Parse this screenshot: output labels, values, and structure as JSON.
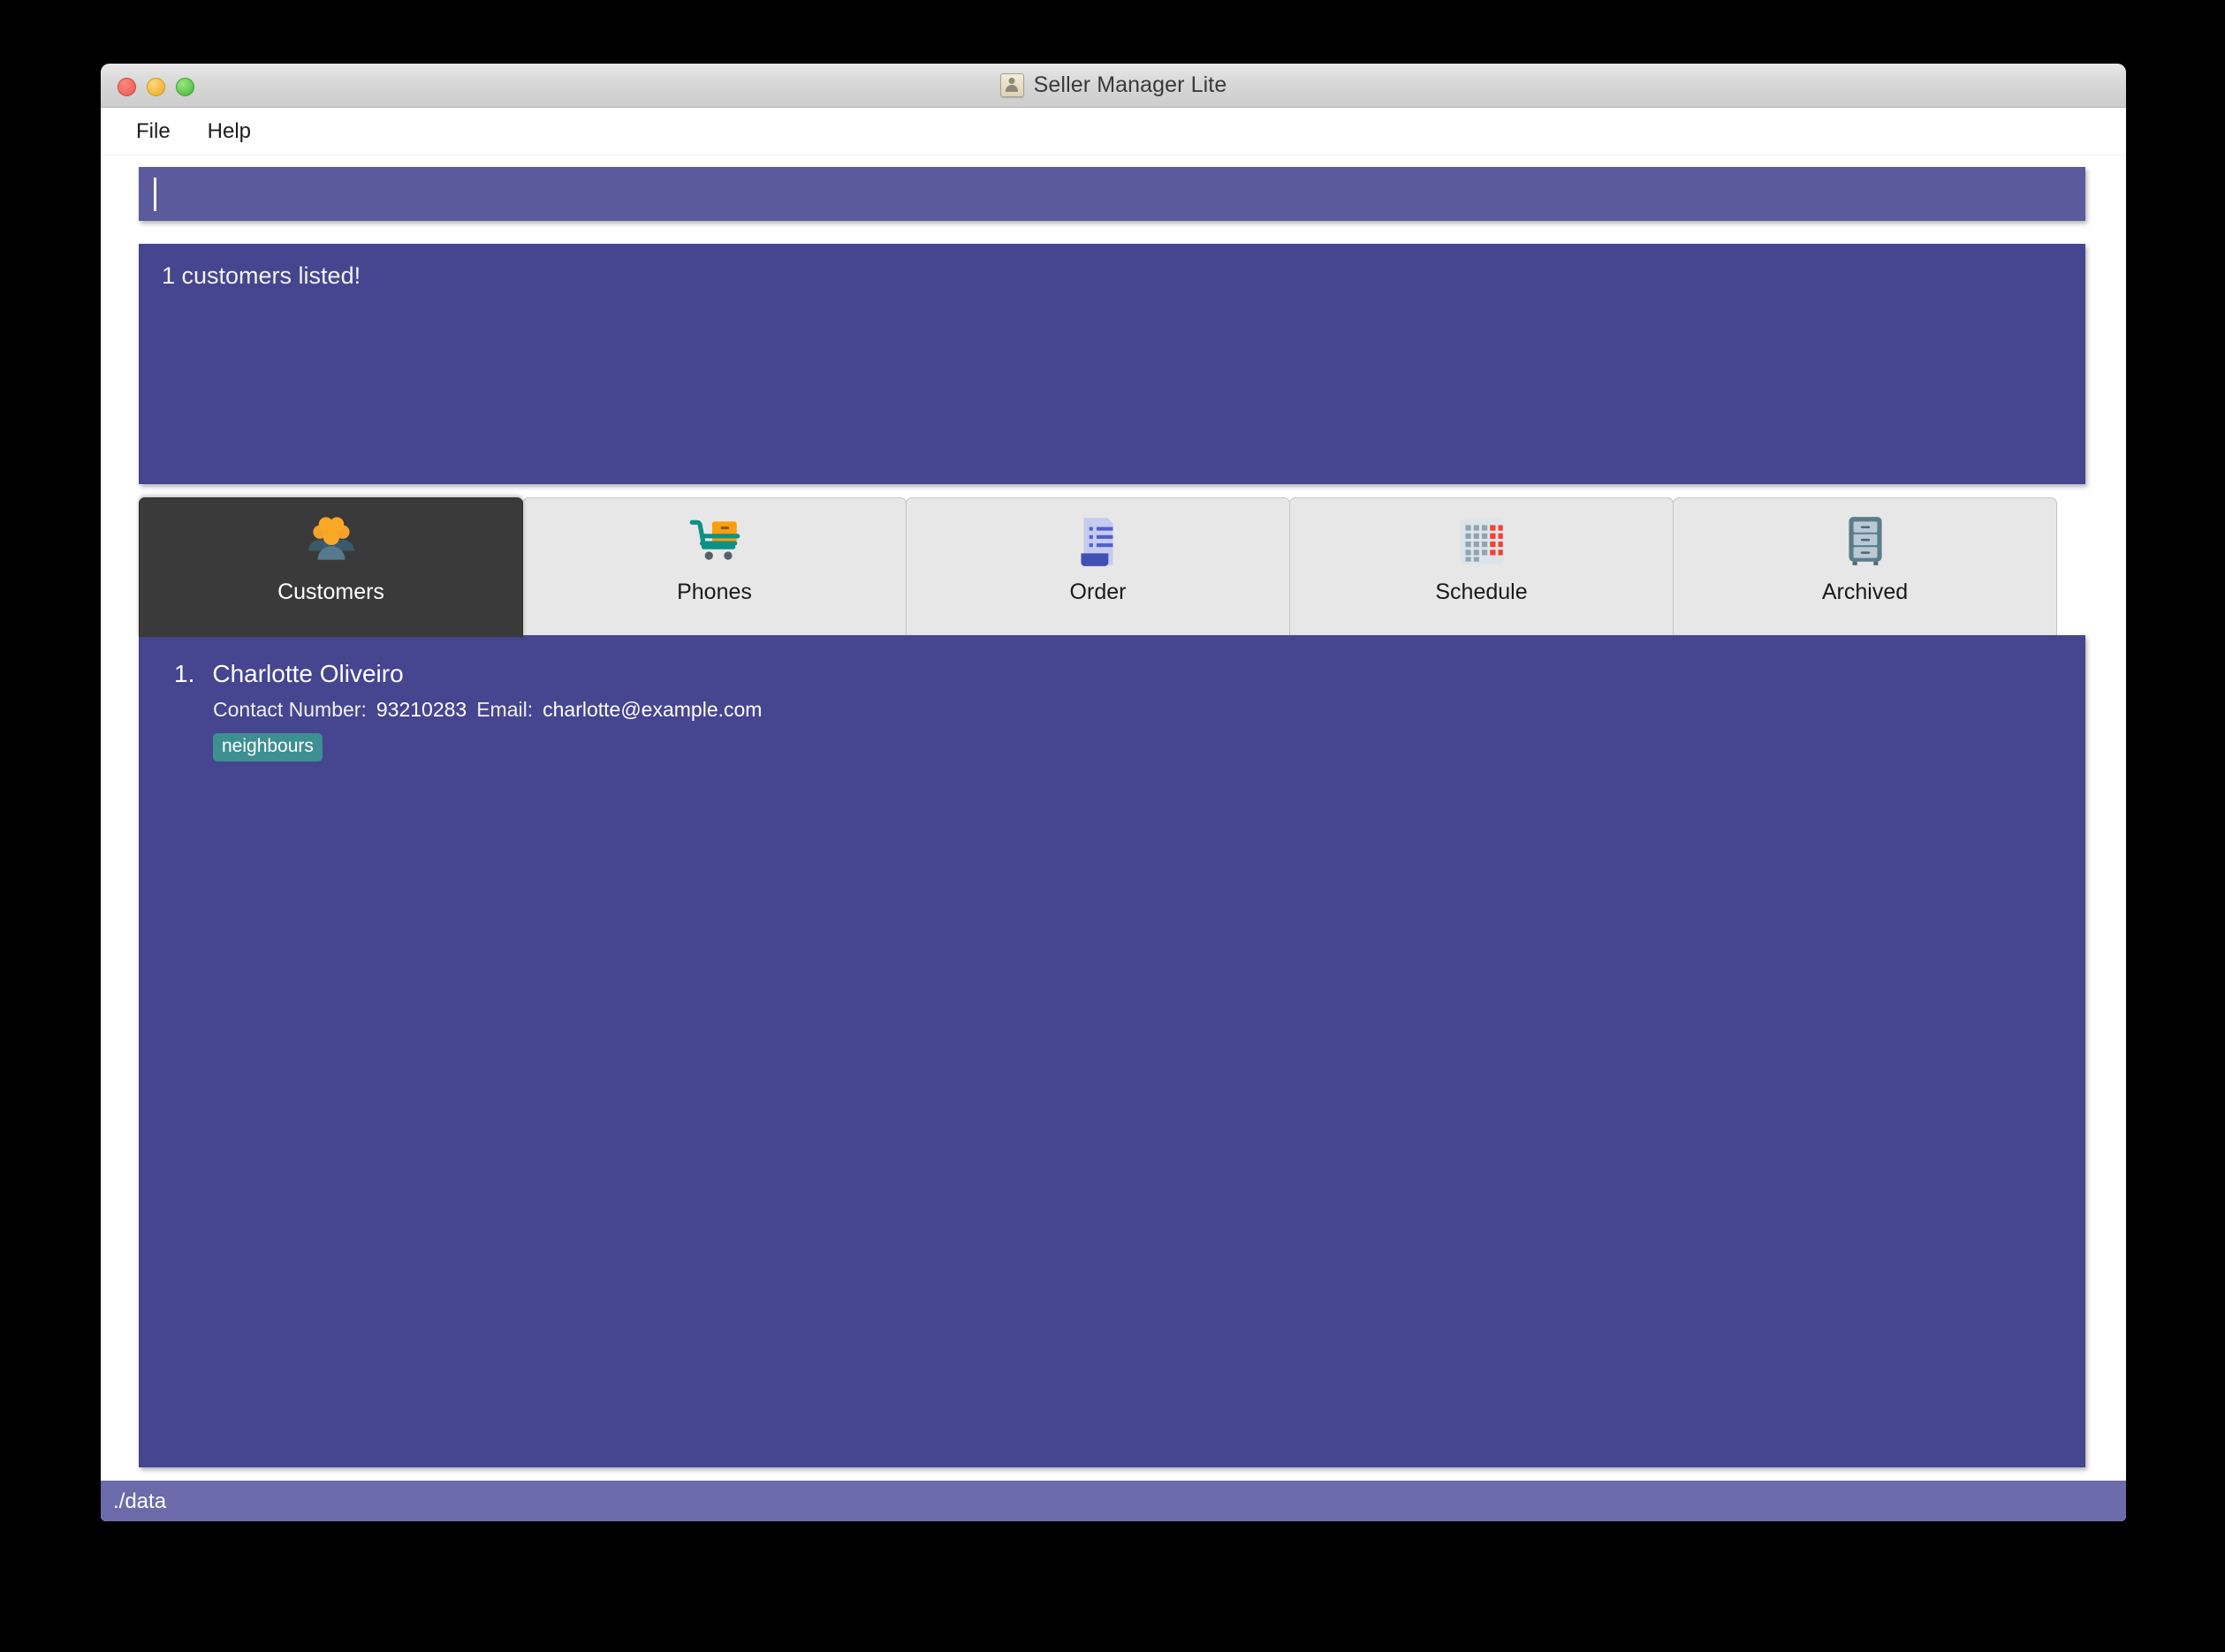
{
  "window": {
    "title": "Seller Manager Lite",
    "title_icon": "contact-card-icon",
    "traffic_lights": {
      "close": "close-window-button",
      "minimize": "minimize-window-button",
      "maximize": "maximize-window-button"
    }
  },
  "menubar": {
    "items": [
      {
        "label": "File",
        "name": "menu-file"
      },
      {
        "label": "Help",
        "name": "menu-help"
      }
    ]
  },
  "command_box": {
    "value": "",
    "placeholder": "",
    "caret_visible": true
  },
  "result_box": {
    "message": "1 customers listed!"
  },
  "tabs": [
    {
      "label": "Customers",
      "icon": "people-group-icon",
      "active": true
    },
    {
      "label": "Phones",
      "icon": "shopping-cart-icon",
      "active": false
    },
    {
      "label": "Order",
      "icon": "document-list-icon",
      "active": false
    },
    {
      "label": "Schedule",
      "icon": "calendar-grid-icon",
      "active": false
    },
    {
      "label": "Archived",
      "icon": "filing-cabinet-icon",
      "active": false
    }
  ],
  "customer_list": {
    "items": [
      {
        "index": "1.",
        "name": "Charlotte Oliveiro",
        "contact_label": "Contact Number:",
        "contact_value": "93210283",
        "email_label": "Email:",
        "email_value": "charlotte@example.com",
        "tags": [
          "neighbours"
        ]
      }
    ]
  },
  "statusbar": {
    "path": "./data"
  },
  "colors": {
    "command_box": "#5A5A9C",
    "result_box": "#454590",
    "list_panel": "#454590",
    "status_bar": "#6B6BAB",
    "active_tab": "#3A3A3A",
    "inactive_tab": "#E7E7E7",
    "tag": "#3E8F91"
  }
}
